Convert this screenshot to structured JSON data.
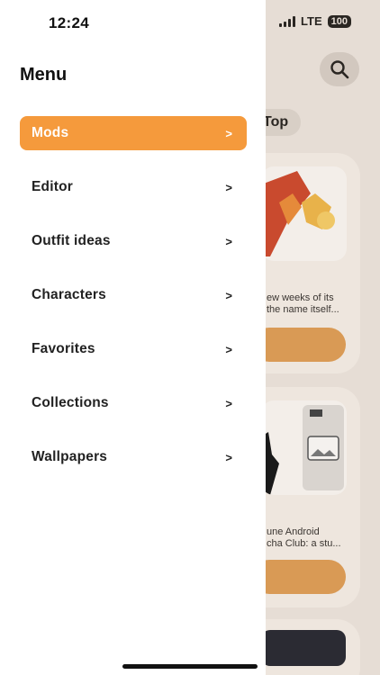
{
  "status_bar": {
    "time": "12:24",
    "network": "LTE",
    "battery": "100"
  },
  "drawer": {
    "title": "Menu",
    "items": [
      {
        "label": "Mods",
        "active": true
      },
      {
        "label": "Editor",
        "active": false
      },
      {
        "label": "Outfit ideas",
        "active": false
      },
      {
        "label": "Characters",
        "active": false
      },
      {
        "label": "Favorites",
        "active": false
      },
      {
        "label": "Collections",
        "active": false
      },
      {
        "label": "Wallpapers",
        "active": false
      }
    ]
  },
  "background": {
    "tab_label": "Top",
    "card1": {
      "line1": "ew weeks of its",
      "line2": "the name itself..."
    },
    "card2": {
      "line1": "une Android",
      "line2": "cha Club: a stu..."
    }
  },
  "colors": {
    "accent": "#f59a3c",
    "drawer_bg": "#ffffff",
    "overlay_bg": "#e6ddd5"
  },
  "icons": {
    "search": "search-icon",
    "chevron": "chevron-right-icon"
  }
}
